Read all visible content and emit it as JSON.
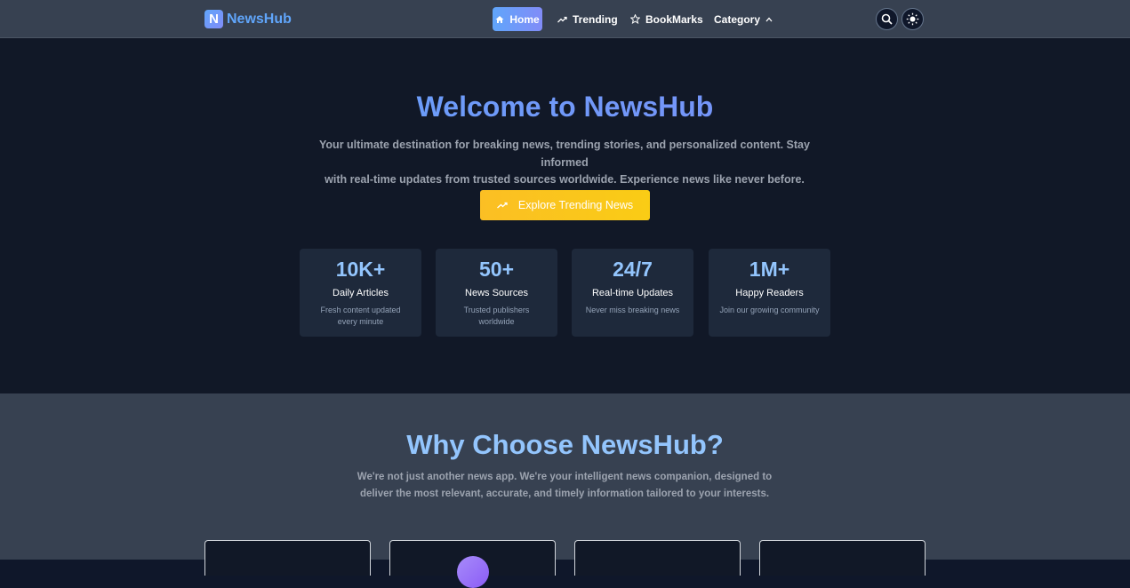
{
  "brand": {
    "logo_letter": "N",
    "name": "NewsHub"
  },
  "nav": {
    "home": "Home",
    "trending": "Trending",
    "bookmarks": "BookMarks",
    "category": "Category"
  },
  "hero": {
    "title": "Welcome to NewsHub",
    "subtitle_line1": "Your ultimate destination for breaking news, trending stories, and personalized content. Stay informed",
    "subtitle_line2": "with real-time updates from trusted sources worldwide. Experience news like never before.",
    "cta": "Explore Trending News"
  },
  "stats": [
    {
      "value": "10K+",
      "label": "Daily Articles",
      "desc": "Fresh content updated every minute"
    },
    {
      "value": "50+",
      "label": "News Sources",
      "desc": "Trusted publishers worldwide"
    },
    {
      "value": "24/7",
      "label": "Real-time Updates",
      "desc": "Never miss breaking news"
    },
    {
      "value": "1M+",
      "label": "Happy Readers",
      "desc": "Join our growing community"
    }
  ],
  "why": {
    "title": "Why Choose NewsHub?",
    "subtitle_line1": "We're not just another news app. We're your intelligent news companion, designed to",
    "subtitle_line2": "deliver the most relevant, accurate, and timely information tailored to your interests."
  },
  "colors": {
    "nav_bg": "#374151",
    "hero_bg": "#111827",
    "accent_blue": "#60a5fa",
    "accent_indigo": "#818cf8",
    "cta_yellow": "#fbbf24",
    "card_bg": "#1e293b"
  },
  "icons": {
    "home": "home-icon",
    "trending": "trending-up-icon",
    "bookmarks": "star-icon",
    "category": "chevron-up-icon",
    "search": "search-icon",
    "theme": "sun-icon"
  }
}
